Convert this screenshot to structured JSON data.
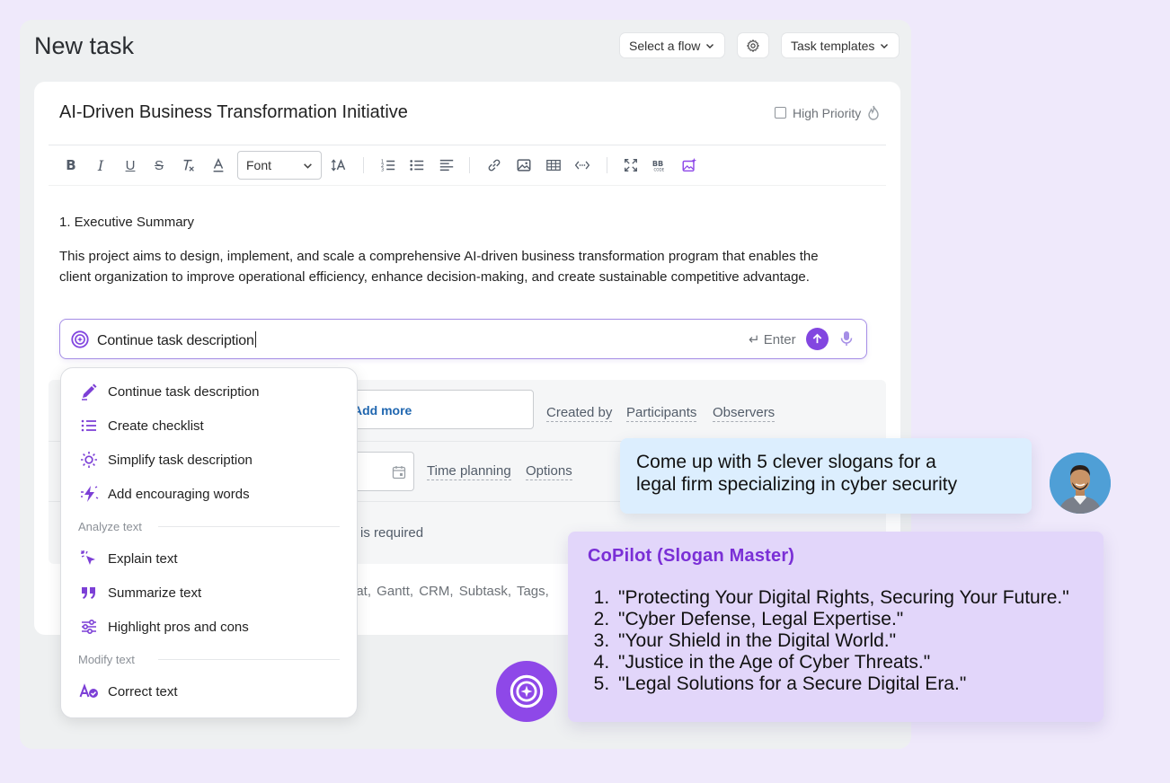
{
  "header": {
    "title": "New task",
    "select_flow": "Select a flow",
    "task_templates": "Task templates"
  },
  "task": {
    "title": "AI-Driven Business Transformation Initiative",
    "high_priority": "High Priority",
    "high_priority_checked": false
  },
  "editor": {
    "font_label": "Font",
    "heading": "1. Executive Summary",
    "paragraph_line1": "This project aims to design, implement, and scale a comprehensive AI-driven business transformation program that enables the",
    "paragraph_line2": "client organization to improve operational efficiency, enhance decision-making, and create sustainable competitive advantage."
  },
  "ai_input": {
    "value": "Continue task description",
    "enter_hint": "Enter"
  },
  "form": {
    "add_more": "Add more",
    "created_by": "Created by",
    "participants": "Participants",
    "observers": "Observers",
    "time_planning": "Time planning",
    "options": "Options",
    "required_text": "is required",
    "tags_line": "eat,   Gantt,   CRM,   Subtask,   Tags,"
  },
  "menu": {
    "items_top": [
      {
        "label": "Continue task description",
        "icon": "pen-icon"
      },
      {
        "label": "Create checklist",
        "icon": "list-icon"
      },
      {
        "label": "Simplify task description",
        "icon": "sun-icon"
      },
      {
        "label": "Add encouraging words",
        "icon": "lightning-icon"
      }
    ],
    "section_analyze": "Analyze text",
    "items_analyze": [
      {
        "label": "Explain text",
        "icon": "cursor-click-icon"
      },
      {
        "label": "Summarize text",
        "icon": "quote-icon"
      },
      {
        "label": "Highlight pros and cons",
        "icon": "sliders-icon"
      }
    ],
    "section_modify": "Modify text",
    "items_modify": [
      {
        "label": "Correct text",
        "icon": "spellcheck-icon"
      }
    ]
  },
  "chat": {
    "question_line1": "Come up with 5 clever slogans for a",
    "question_line2": "legal firm specializing in cyber security",
    "assistant_name": "CoPilot (Slogan Master)",
    "answers": [
      "\"Protecting Your Digital Rights, Securing Your Future.\"",
      "\"Cyber Defense, Legal Expertise.\"",
      "\"Your Shield in the Digital World.\"",
      "\"Justice in the Age of Cyber Threats.\"",
      "\"Legal Solutions for a Secure Digital Era.\""
    ]
  },
  "colors": {
    "accent_purple": "#8246e0",
    "link_blue": "#2067b0",
    "question_bubble": "#dceefe",
    "answer_bubble": "#e2d6fa",
    "background": "#efe9fb"
  }
}
